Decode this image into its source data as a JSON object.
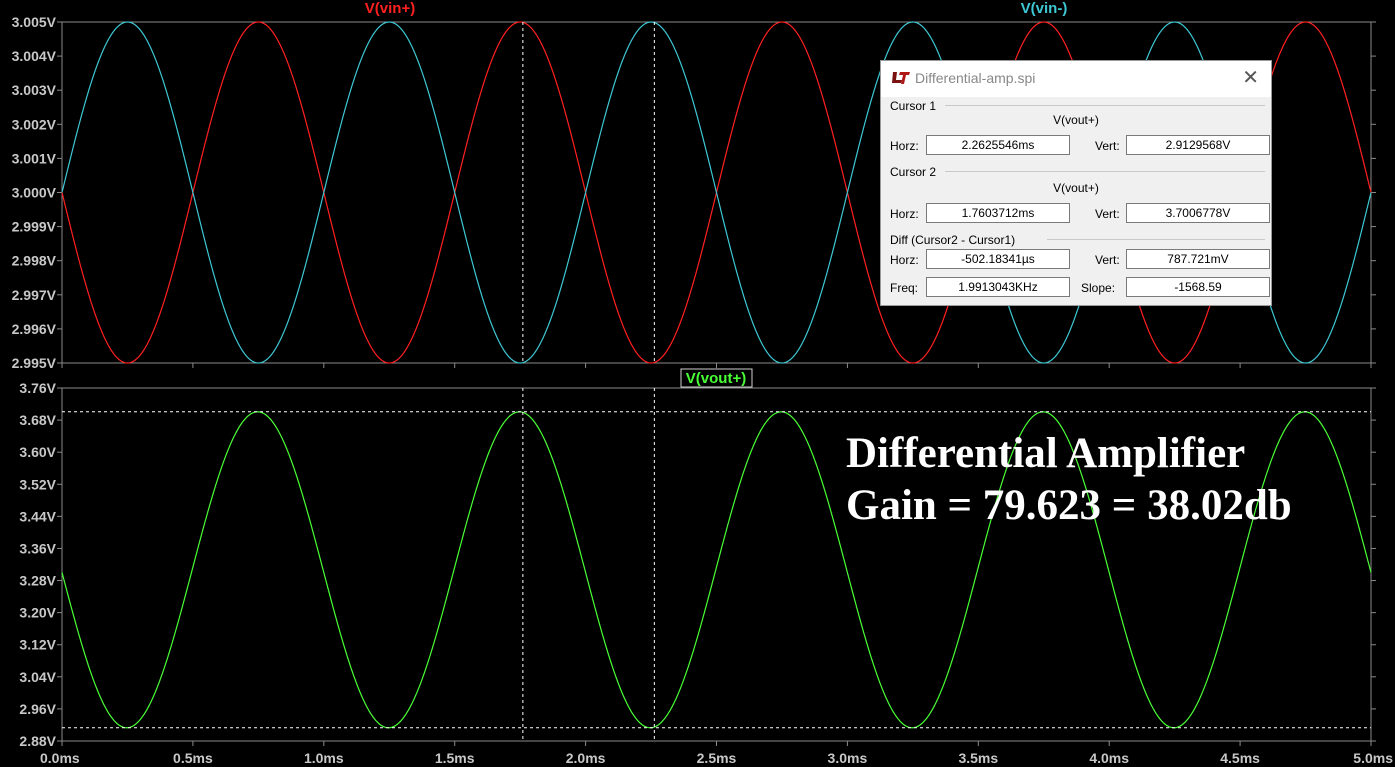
{
  "colors": {
    "background": "#000000",
    "grid_frame": "#8a8a8a",
    "vin_plus": "#ff2020",
    "vin_minus": "#3ec8d4",
    "vout_plus": "#49ff35",
    "cursor_line": "#ffffff",
    "axis_text": "#c8c8c8"
  },
  "panes": {
    "top": {
      "y_ticks": [
        "3.005V",
        "3.004V",
        "3.003V",
        "3.002V",
        "3.001V",
        "3.000V",
        "2.999V",
        "2.998V",
        "2.997V",
        "2.996V",
        "2.995V"
      ]
    },
    "bottom": {
      "y_ticks": [
        "3.76V",
        "3.68V",
        "3.60V",
        "3.52V",
        "3.44V",
        "3.36V",
        "3.28V",
        "3.20V",
        "3.12V",
        "3.04V",
        "2.96V",
        "2.88V"
      ]
    }
  },
  "x_ticks": [
    "0.0ms",
    "0.5ms",
    "1.0ms",
    "1.5ms",
    "2.0ms",
    "2.5ms",
    "3.0ms",
    "3.5ms",
    "4.0ms",
    "4.5ms",
    "5.0ms"
  ],
  "chart_data": [
    {
      "type": "line",
      "pane": "top",
      "x_range": [
        0,
        5
      ],
      "x_unit": "ms",
      "ylim": [
        2.995,
        3.005
      ],
      "grid": false,
      "series": [
        {
          "name": "V(vin+)",
          "color": "#ff2020",
          "function": "sine",
          "offset": 3.0,
          "amplitude": 0.005,
          "frequency_khz": 1.0,
          "initial_direction": "down"
        },
        {
          "name": "V(vin-)",
          "color": "#3ec8d4",
          "function": "sine",
          "offset": 3.0,
          "amplitude": 0.005,
          "frequency_khz": 1.0,
          "initial_direction": "up"
        }
      ],
      "cursor_x_ms": [
        1.7603712,
        2.2625546
      ]
    },
    {
      "type": "line",
      "pane": "bottom",
      "x_range": [
        0,
        5
      ],
      "x_unit": "ms",
      "ylim": [
        2.88,
        3.76
      ],
      "grid": false,
      "series": [
        {
          "name": "V(vout+)",
          "color": "#49ff35",
          "function": "sine",
          "offset": 3.3068,
          "amplitude": 0.3938,
          "frequency_khz": 1.0,
          "initial_direction": "down",
          "start_value": 3.3
        }
      ],
      "cursor_x_ms": [
        1.7603712,
        2.2625546
      ],
      "cursor_y_v": [
        2.9129568,
        3.7006778
      ]
    }
  ],
  "annotation": {
    "line1": "Differential Amplifier",
    "line2": "Gain = 79.623 = 38.02db"
  },
  "dialog": {
    "title": "Differential-amp.spi",
    "cursor1": {
      "label": "Cursor 1",
      "trace": "V(vout+)",
      "horz_label": "Horz:",
      "horz": "2.2625546ms",
      "vert_label": "Vert:",
      "vert": "2.9129568V"
    },
    "cursor2": {
      "label": "Cursor 2",
      "trace": "V(vout+)",
      "horz_label": "Horz:",
      "horz": "1.7603712ms",
      "vert_label": "Vert:",
      "vert": "3.7006778V"
    },
    "diff": {
      "label": "Diff (Cursor2 - Cursor1)",
      "horz_label": "Horz:",
      "horz": "-502.18341µs",
      "vert_label": "Vert:",
      "vert": "787.721mV",
      "freq_label": "Freq:",
      "freq": "1.9913043KHz",
      "slope_label": "Slope:",
      "slope": "-1568.59"
    }
  }
}
